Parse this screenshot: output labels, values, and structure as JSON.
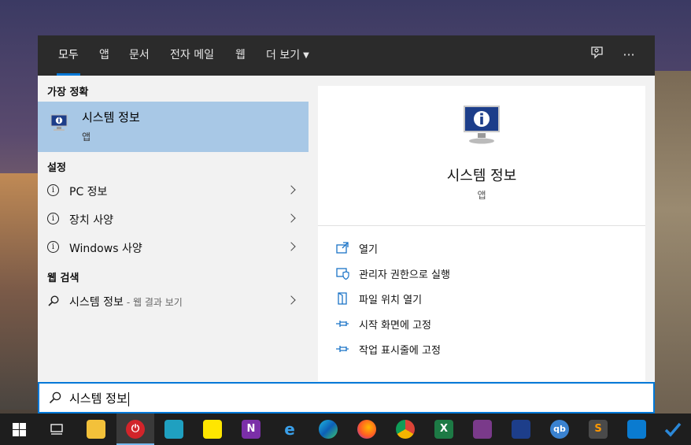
{
  "tabs": [
    {
      "label": "모두",
      "active": true
    },
    {
      "label": "앱"
    },
    {
      "label": "문서"
    },
    {
      "label": "전자 메일"
    },
    {
      "label": "웹"
    },
    {
      "label": "더 보기"
    }
  ],
  "top_icons": [
    "feedback-icon",
    "more-options-icon"
  ],
  "more_glyph": "···",
  "left": {
    "best_match_title": "가장 정확",
    "best_match": {
      "name": "시스템 정보",
      "type": "앱",
      "icon": "system-info-icon"
    },
    "settings_title": "설정",
    "settings": [
      {
        "label": "PC 정보",
        "icon": "info-icon"
      },
      {
        "label": "장치 사양",
        "icon": "info-icon"
      },
      {
        "label": "Windows 사양",
        "icon": "info-icon"
      }
    ],
    "web_title": "웹 검색",
    "web": {
      "label": "시스템 정보",
      "sub": "- 웹 결과 보기",
      "icon": "search-icon"
    }
  },
  "info_glyph": "i",
  "right": {
    "title": "시스템 정보",
    "subtitle": "앱",
    "actions": [
      {
        "label": "열기",
        "icon": "open-icon"
      },
      {
        "label": "관리자 권한으로 실행",
        "icon": "admin-shield-icon"
      },
      {
        "label": "파일 위치 열기",
        "icon": "file-location-icon"
      },
      {
        "label": "시작 화면에 고정",
        "icon": "pin-icon"
      },
      {
        "label": "작업 표시줄에 고정",
        "icon": "pin-icon"
      }
    ]
  },
  "search": {
    "value": "시스템 정보"
  },
  "taskbar": [
    {
      "name": "start-icon"
    },
    {
      "name": "task-view-icon"
    },
    {
      "name": "file-explorer-icon"
    },
    {
      "name": "power-app-icon",
      "active": true
    },
    {
      "name": "buildings-app-icon"
    },
    {
      "name": "sticky-notes-icon"
    },
    {
      "name": "onenote-icon",
      "glyph": "N"
    },
    {
      "name": "internet-explorer-icon",
      "glyph": "e"
    },
    {
      "name": "edge-icon"
    },
    {
      "name": "firefox-icon"
    },
    {
      "name": "chrome-icon"
    },
    {
      "name": "excel-icon",
      "glyph": "X"
    },
    {
      "name": "speedometer-app-icon"
    },
    {
      "name": "system-info-app-icon"
    },
    {
      "name": "qbittorrent-icon",
      "glyph": "qb"
    },
    {
      "name": "sublime-text-icon",
      "glyph": "S"
    },
    {
      "name": "vscode-icon"
    },
    {
      "name": "todo-icon"
    }
  ],
  "colors": {
    "accent": "#0078d7",
    "selection": "#a8c8e6",
    "topbar": "#2b2b2b",
    "taskbar": "#1e1e1e"
  }
}
